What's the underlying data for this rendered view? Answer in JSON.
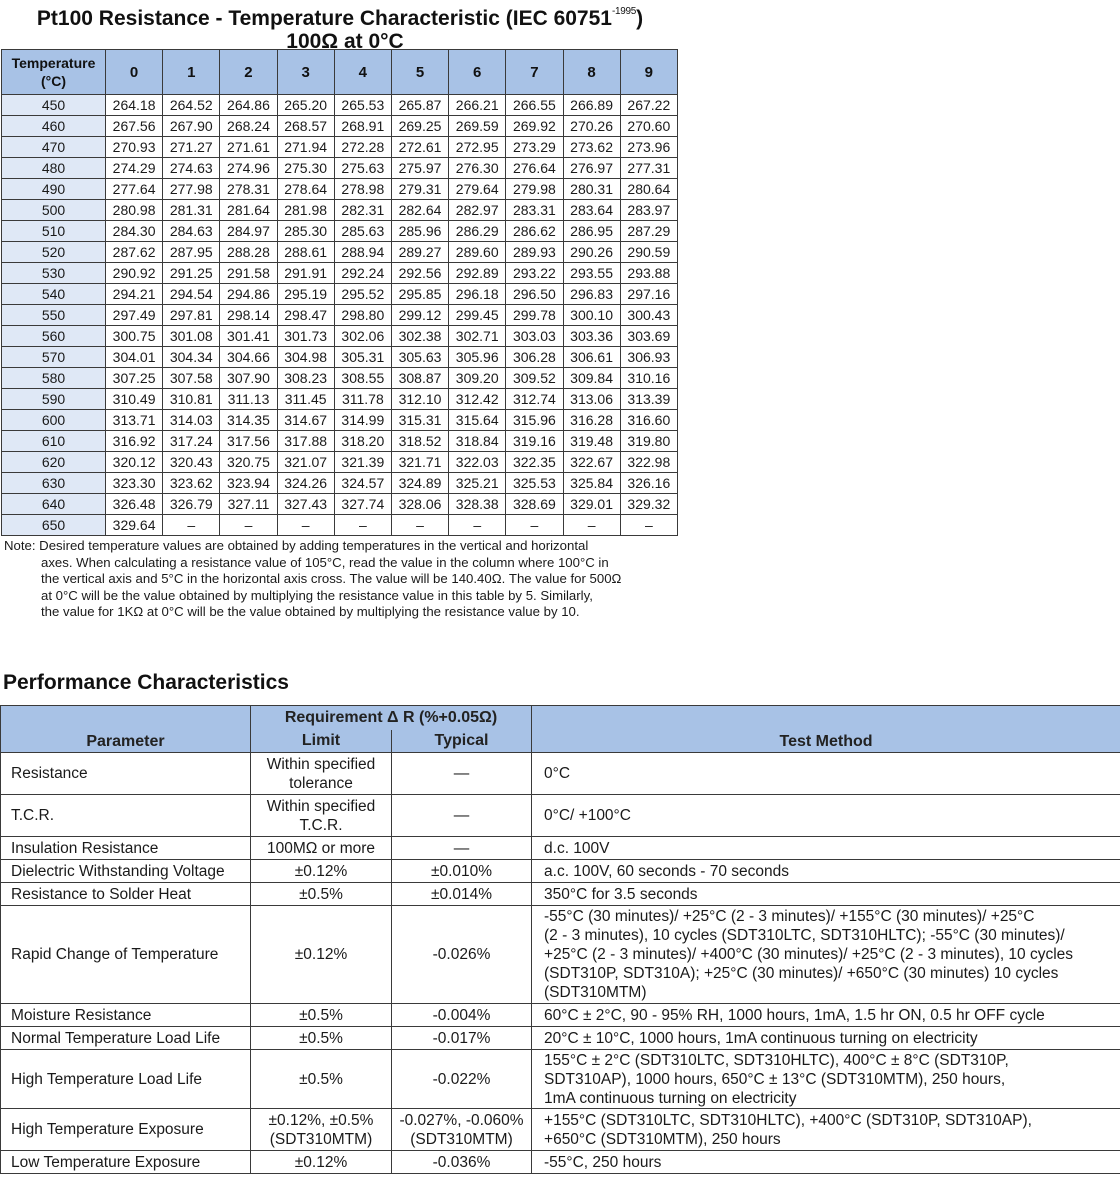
{
  "title": {
    "line1": "Pt100 Resistance - Temperature Characteristic (IEC 60751",
    "sup": "-1995",
    "close": ")",
    "line2": "100Ω at 0°C"
  },
  "resistance_table": {
    "temp_header": [
      "Temperature",
      "(°C)"
    ],
    "columns": [
      "0",
      "1",
      "2",
      "3",
      "4",
      "5",
      "6",
      "7",
      "8",
      "9"
    ],
    "rows": [
      {
        "t": "450",
        "v": [
          "264.18",
          "264.52",
          "264.86",
          "265.20",
          "265.53",
          "265.87",
          "266.21",
          "266.55",
          "266.89",
          "267.22"
        ]
      },
      {
        "t": "460",
        "v": [
          "267.56",
          "267.90",
          "268.24",
          "268.57",
          "268.91",
          "269.25",
          "269.59",
          "269.92",
          "270.26",
          "270.60"
        ]
      },
      {
        "t": "470",
        "v": [
          "270.93",
          "271.27",
          "271.61",
          "271.94",
          "272.28",
          "272.61",
          "272.95",
          "273.29",
          "273.62",
          "273.96"
        ]
      },
      {
        "t": "480",
        "v": [
          "274.29",
          "274.63",
          "274.96",
          "275.30",
          "275.63",
          "275.97",
          "276.30",
          "276.64",
          "276.97",
          "277.31"
        ]
      },
      {
        "t": "490",
        "v": [
          "277.64",
          "277.98",
          "278.31",
          "278.64",
          "278.98",
          "279.31",
          "279.64",
          "279.98",
          "280.31",
          "280.64"
        ]
      },
      {
        "t": "500",
        "v": [
          "280.98",
          "281.31",
          "281.64",
          "281.98",
          "282.31",
          "282.64",
          "282.97",
          "283.31",
          "283.64",
          "283.97"
        ]
      },
      {
        "t": "510",
        "v": [
          "284.30",
          "284.63",
          "284.97",
          "285.30",
          "285.63",
          "285.96",
          "286.29",
          "286.62",
          "286.95",
          "287.29"
        ]
      },
      {
        "t": "520",
        "v": [
          "287.62",
          "287.95",
          "288.28",
          "288.61",
          "288.94",
          "289.27",
          "289.60",
          "289.93",
          "290.26",
          "290.59"
        ]
      },
      {
        "t": "530",
        "v": [
          "290.92",
          "291.25",
          "291.58",
          "291.91",
          "292.24",
          "292.56",
          "292.89",
          "293.22",
          "293.55",
          "293.88"
        ]
      },
      {
        "t": "540",
        "v": [
          "294.21",
          "294.54",
          "294.86",
          "295.19",
          "295.52",
          "295.85",
          "296.18",
          "296.50",
          "296.83",
          "297.16"
        ]
      },
      {
        "t": "550",
        "v": [
          "297.49",
          "297.81",
          "298.14",
          "298.47",
          "298.80",
          "299.12",
          "299.45",
          "299.78",
          "300.10",
          "300.43"
        ]
      },
      {
        "t": "560",
        "v": [
          "300.75",
          "301.08",
          "301.41",
          "301.73",
          "302.06",
          "302.38",
          "302.71",
          "303.03",
          "303.36",
          "303.69"
        ]
      },
      {
        "t": "570",
        "v": [
          "304.01",
          "304.34",
          "304.66",
          "304.98",
          "305.31",
          "305.63",
          "305.96",
          "306.28",
          "306.61",
          "306.93"
        ]
      },
      {
        "t": "580",
        "v": [
          "307.25",
          "307.58",
          "307.90",
          "308.23",
          "308.55",
          "308.87",
          "309.20",
          "309.52",
          "309.84",
          "310.16"
        ]
      },
      {
        "t": "590",
        "v": [
          "310.49",
          "310.81",
          "311.13",
          "311.45",
          "311.78",
          "312.10",
          "312.42",
          "312.74",
          "313.06",
          "313.39"
        ]
      },
      {
        "t": "600",
        "v": [
          "313.71",
          "314.03",
          "314.35",
          "314.67",
          "314.99",
          "315.31",
          "315.64",
          "315.96",
          "316.28",
          "316.60"
        ]
      },
      {
        "t": "610",
        "v": [
          "316.92",
          "317.24",
          "317.56",
          "317.88",
          "318.20",
          "318.52",
          "318.84",
          "319.16",
          "319.48",
          "319.80"
        ]
      },
      {
        "t": "620",
        "v": [
          "320.12",
          "320.43",
          "320.75",
          "321.07",
          "321.39",
          "321.71",
          "322.03",
          "322.35",
          "322.67",
          "322.98"
        ]
      },
      {
        "t": "630",
        "v": [
          "323.30",
          "323.62",
          "323.94",
          "324.26",
          "324.57",
          "324.89",
          "325.21",
          "325.53",
          "325.84",
          "326.16"
        ]
      },
      {
        "t": "640",
        "v": [
          "326.48",
          "326.79",
          "327.11",
          "327.43",
          "327.74",
          "328.06",
          "328.38",
          "328.69",
          "329.01",
          "329.32"
        ]
      },
      {
        "t": "650",
        "v": [
          "329.64",
          "–",
          "–",
          "–",
          "–",
          "–",
          "–",
          "–",
          "–",
          "–"
        ]
      }
    ]
  },
  "note": {
    "lines": [
      "Note: Desired temperature values are obtained by adding temperatures in the vertical and horizontal",
      "axes. When calculating a resistance value of 105°C, read the value in the column where 100°C in",
      "the vertical axis and 5°C in the horizontal axis cross. The value will be 140.40Ω. The value for 500Ω",
      "at 0°C will be the value obtained by multiplying the resistance value in this table by 5. Similarly,",
      "the value for 1KΩ at 0°C will be the value obtained by multiplying the resistance value by 10."
    ]
  },
  "performance": {
    "heading": "Performance Characteristics",
    "headers": {
      "parameter": "Parameter",
      "requirement": "Requirement Δ R (%+0.05Ω)",
      "limit": "Limit",
      "typical": "Typical",
      "method": "Test Method"
    },
    "rows": [
      {
        "param": "Resistance",
        "limit": [
          "Within specified",
          "tolerance"
        ],
        "typical": [
          "—"
        ],
        "method": [
          "0°C"
        ]
      },
      {
        "param": "T.C.R.",
        "limit": [
          "Within specified",
          "T.C.R."
        ],
        "typical": [
          "—"
        ],
        "method": [
          "0°C/ +100°C"
        ]
      },
      {
        "param": "Insulation Resistance",
        "limit": [
          "100MΩ or more"
        ],
        "typical": [
          "—"
        ],
        "method": [
          "d.c. 100V"
        ]
      },
      {
        "param": "Dielectric Withstanding Voltage",
        "limit": [
          "±0.12%"
        ],
        "typical": [
          "±0.010%"
        ],
        "method": [
          "a.c. 100V, 60 seconds - 70 seconds"
        ]
      },
      {
        "param": "Resistance to Solder Heat",
        "limit": [
          "±0.5%"
        ],
        "typical": [
          "±0.014%"
        ],
        "method": [
          "350°C for 3.5 seconds"
        ]
      },
      {
        "param": "Rapid Change of Temperature",
        "limit": [
          "±0.12%"
        ],
        "typical": [
          "-0.026%"
        ],
        "method": [
          "-55°C (30 minutes)/ +25°C (2 - 3 minutes)/ +155°C (30 minutes)/ +25°C",
          "(2 - 3 minutes), 10 cycles (SDT310LTC, SDT310HLTC); -55°C (30 minutes)/",
          "+25°C (2 - 3 minutes)/ +400°C (30 minutes)/ +25°C (2 - 3 minutes), 10 cycles",
          "(SDT310P, SDT310A); +25°C (30 minutes)/ +650°C (30 minutes) 10 cycles",
          "(SDT310MTM)"
        ]
      },
      {
        "param": "Moisture Resistance",
        "limit": [
          "±0.5%"
        ],
        "typical": [
          "-0.004%"
        ],
        "method": [
          "60°C ± 2°C, 90 - 95% RH, 1000 hours, 1mA, 1.5 hr ON, 0.5 hr OFF cycle"
        ]
      },
      {
        "param": "Normal Temperature Load Life",
        "limit": [
          "±0.5%"
        ],
        "typical": [
          "-0.017%"
        ],
        "method": [
          "20°C ± 10°C, 1000 hours, 1mA continuous turning on electricity"
        ]
      },
      {
        "param": "High Temperature Load Life",
        "limit": [
          "±0.5%"
        ],
        "typical": [
          "-0.022%"
        ],
        "method": [
          "155°C ± 2°C (SDT310LTC, SDT310HLTC), 400°C ± 8°C (SDT310P,",
          "SDT310AP), 1000 hours, 650°C ± 13°C (SDT310MTM), 250 hours,",
          "1mA continuous turning on electricity"
        ]
      },
      {
        "param": "High Temperature Exposure",
        "limit": [
          "±0.12%, ±0.5%",
          "(SDT310MTM)"
        ],
        "typical": [
          "-0.027%, -0.060%",
          "(SDT310MTM)"
        ],
        "method": [
          "+155°C (SDT310LTC, SDT310HLTC), +400°C (SDT310P, SDT310AP),",
          "+650°C (SDT310MTM), 250 hours"
        ]
      },
      {
        "param": "Low Temperature Exposure",
        "limit": [
          "±0.12%"
        ],
        "typical": [
          "-0.036%"
        ],
        "method": [
          "-55°C, 250 hours"
        ]
      }
    ]
  }
}
